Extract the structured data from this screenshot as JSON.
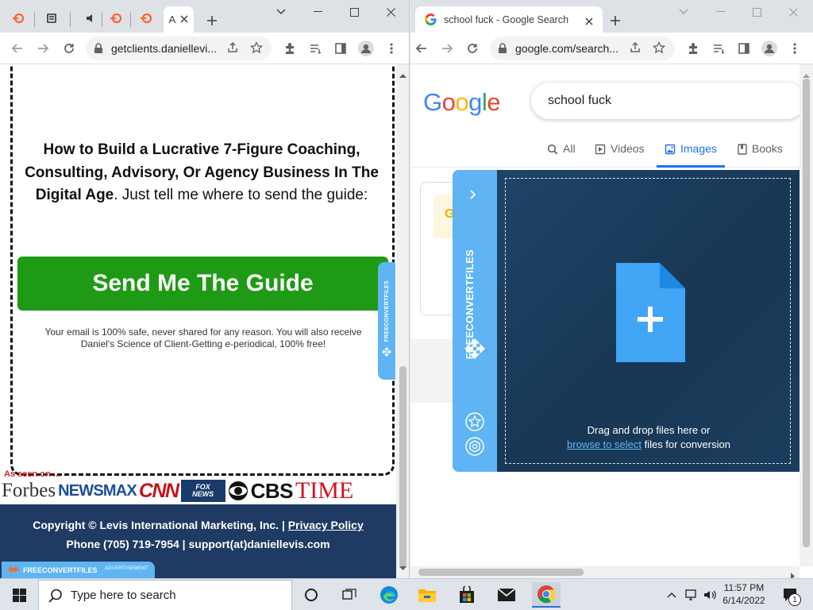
{
  "left_window": {
    "tabs": [
      {
        "icon": "semrush-icon",
        "label": "",
        "active": false
      },
      {
        "icon": "extension-icon",
        "label": "",
        "active": false
      },
      {
        "icon": "audio-icon",
        "label": "",
        "active": false
      },
      {
        "icon": "semrush-icon",
        "label": "",
        "active": false
      },
      {
        "icon": "semrush-icon",
        "label": "",
        "active": false
      },
      {
        "icon": "",
        "label": "A",
        "active": true
      }
    ],
    "url": "getclients.daniellevi...",
    "page": {
      "headline_bold": "How to Build a Lucrative 7-Figure Coaching, Consulting, Advisory, Or Agency Business In The Digital Age",
      "headline_rest": ". Just tell me where to send the guide:",
      "cta_label": "Send Me The Guide",
      "fine_print": "Your email is 100% safe, never shared for any reason. You will also receive Daniel's Science of Client-Getting e-periodical, 100% free!",
      "side_tab_text": "FREECONVERTFILES",
      "as_seen_on": "As seen on ...",
      "logos": [
        "Forbes",
        "NEWSMAX",
        "CNN",
        "FOX NEWS",
        "CBS",
        "TIME"
      ],
      "footer": {
        "copyright": "Copyright © Levis International Marketing, Inc. | ",
        "privacy_link": "Privacy Policy",
        "contact": "Phone (705) 719-7954 | support(at)daniellevis.com"
      },
      "ad_bar": {
        "brand": "FREECONVERTFILES",
        "tag": "ADVERTISEMENT"
      }
    }
  },
  "right_window": {
    "tab": {
      "title": "school fuck - Google Search",
      "icon": "google-icon"
    },
    "url": "google.com/search...",
    "page": {
      "logo": "Google",
      "query": "school fuck",
      "tabs": [
        {
          "label": "All",
          "icon": "search-icon",
          "selected": false
        },
        {
          "label": "Videos",
          "icon": "video-icon",
          "selected": false
        },
        {
          "label": "Images",
          "icon": "image-icon",
          "selected": true
        },
        {
          "label": "Books",
          "icon": "book-icon",
          "selected": false
        }
      ],
      "card_chip": "G"
    },
    "fcf_panel": {
      "side_label": "FREECONVERTFILES",
      "drop_line": "Drag and drop files here or",
      "browse_link": "browse to select",
      "drop_suffix": " files for conversion"
    }
  },
  "taskbar": {
    "search_placeholder": "Type here to search",
    "time": "11:57 PM",
    "date": "6/14/2022",
    "notification_count": "1",
    "apps": [
      "task-view",
      "edge",
      "file-explorer",
      "store",
      "mail",
      "chrome"
    ]
  },
  "colors": {
    "cta_green": "#1f9a15",
    "fcf_blue": "#5fb4f4",
    "footer_navy": "#1f3a63",
    "google_blue": "#1a73e8"
  }
}
